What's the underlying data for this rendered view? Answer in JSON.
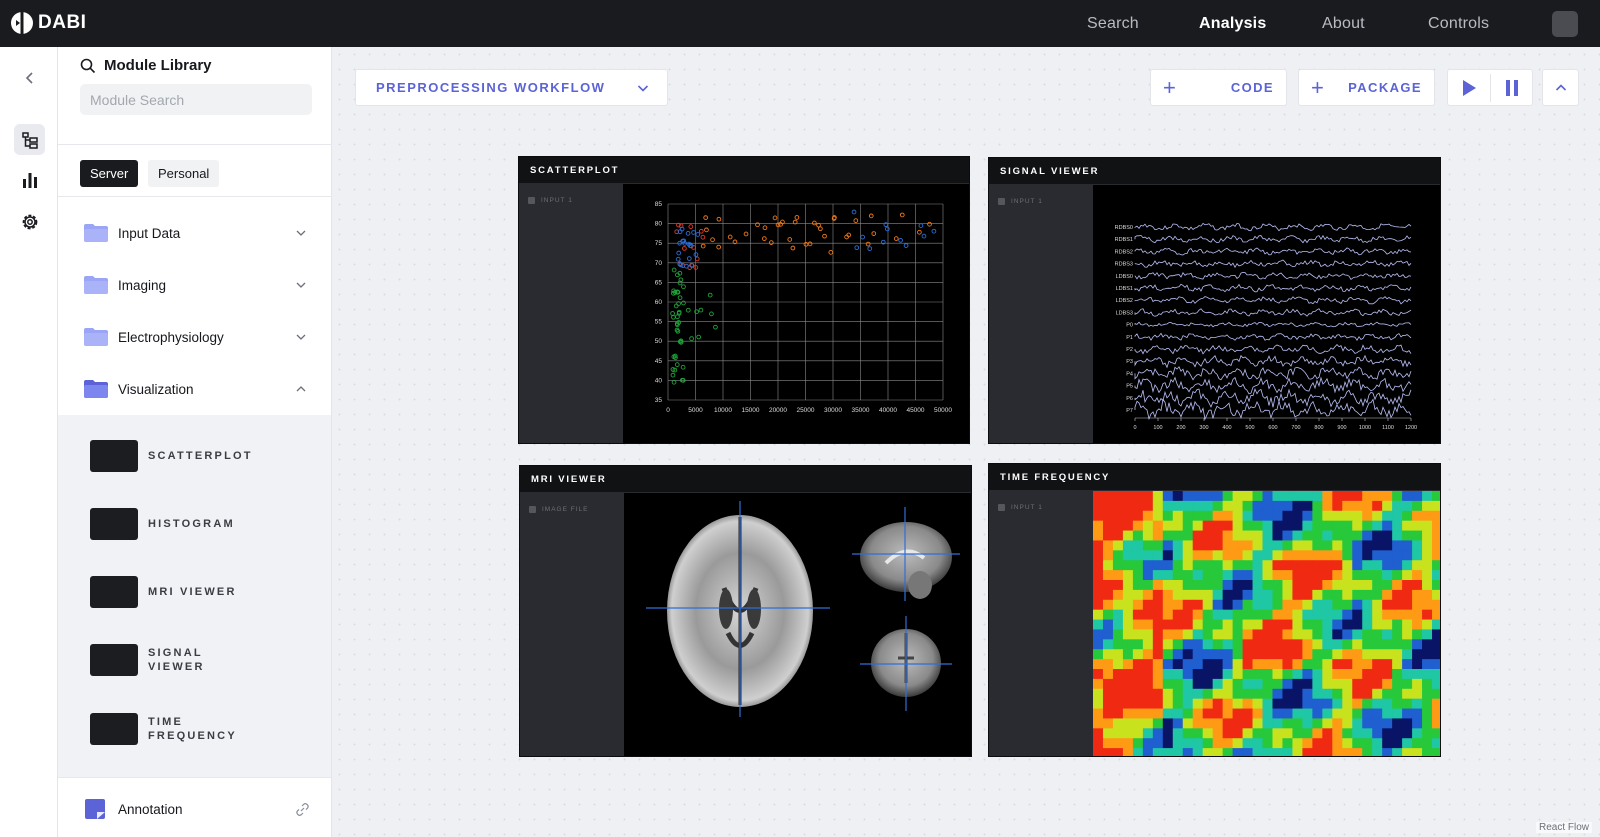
{
  "topbar": {
    "brand": "DABI",
    "nav": [
      {
        "label": "Search",
        "active": false
      },
      {
        "label": "Analysis",
        "active": true
      },
      {
        "label": "About",
        "active": false
      },
      {
        "label": "Controls",
        "active": false
      }
    ]
  },
  "rail": {
    "icons": [
      "chevron-left-icon",
      "tree-icon",
      "bar-chart-icon",
      "gear-icon"
    ]
  },
  "library": {
    "title": "Module Library",
    "search_placeholder": "Module Search",
    "tabs": [
      "Server",
      "Personal"
    ],
    "active_tab": "Server",
    "categories": [
      {
        "label": "Input Data",
        "expanded": false
      },
      {
        "label": "Imaging",
        "expanded": false
      },
      {
        "label": "Electrophysiology",
        "expanded": false
      },
      {
        "label": "Visualization",
        "expanded": true
      }
    ],
    "modules": [
      {
        "line1": "SCATTERPLOT",
        "line2": ""
      },
      {
        "line1": "HISTOGRAM",
        "line2": ""
      },
      {
        "line1": "MRI VIEWER",
        "line2": ""
      },
      {
        "line1": "SIGNAL",
        "line2": "VIEWER"
      },
      {
        "line1": "TIME",
        "line2": "FREQUENCY"
      }
    ],
    "annotation": "Annotation"
  },
  "toolbar": {
    "workflow": "PREPROCESSING WORKFLOW",
    "code_label": "CODE",
    "package_label": "PACKAGE",
    "plus": "+"
  },
  "nodes": {
    "scatterplot": {
      "title": "SCATTERPLOT",
      "port": "INPUT 1"
    },
    "signal": {
      "title": "SIGNAL VIEWER",
      "port": "INPUT 1"
    },
    "mri": {
      "title": "MRI VIEWER",
      "port": "IMAGE FILE"
    },
    "tf": {
      "title": "TIME FREQUENCY",
      "port": "INPUT 1"
    }
  },
  "scatter_axes": {
    "x_ticks": [
      "0",
      "5000",
      "10000",
      "15000",
      "20000",
      "25000",
      "30000",
      "35000",
      "40000",
      "45000",
      "50000"
    ],
    "y_ticks": [
      "35",
      "40",
      "45",
      "50",
      "55",
      "60",
      "65",
      "70",
      "75",
      "80",
      "85"
    ]
  },
  "signal_axes": {
    "channels": [
      "RDBS0",
      "RDBS1",
      "RDBS2",
      "RDBS3",
      "LDBS0",
      "LDBS1",
      "LDBS2",
      "LDBS3",
      "P0",
      "P1",
      "P2",
      "P3",
      "P4",
      "P5",
      "P6",
      "P7"
    ],
    "x_ticks": [
      "0",
      "100",
      "200",
      "300",
      "400",
      "500",
      "600",
      "700",
      "800",
      "900",
      "1000",
      "1100",
      "1200"
    ]
  },
  "footer": {
    "react_flow": "React Flow"
  },
  "colors": {
    "accent": "#5b63d6",
    "topbar": "#1a1b1f",
    "node": "#1c1d21",
    "folder": "#9aa5f5"
  }
}
